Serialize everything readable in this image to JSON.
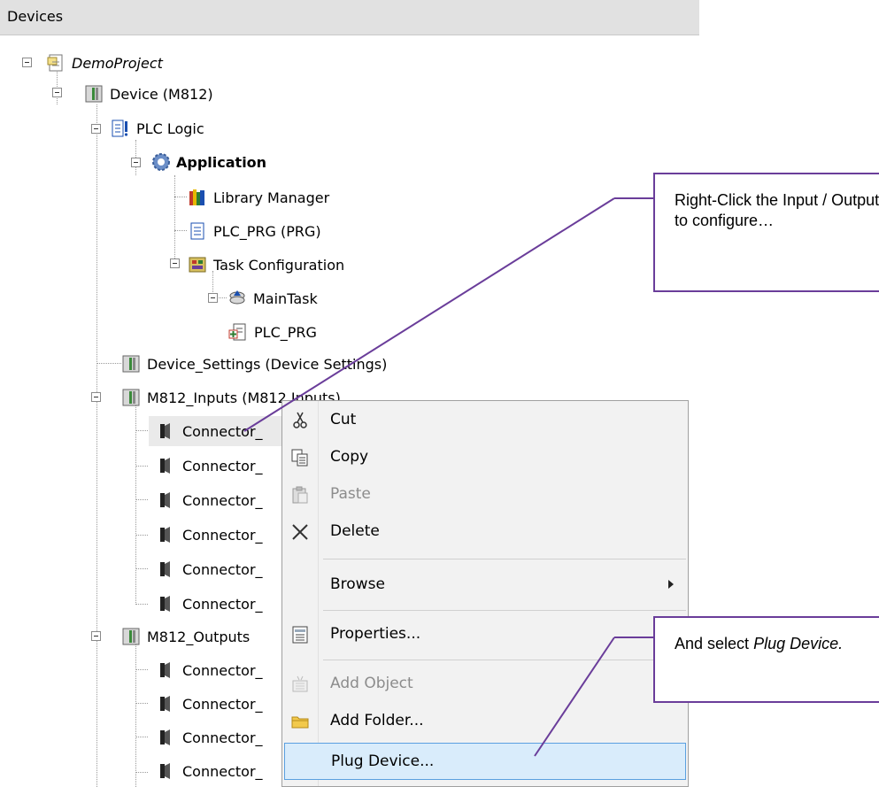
{
  "panel": {
    "title": "Devices"
  },
  "tree": {
    "items": [
      {
        "label": "DemoProject",
        "icon": "project-icon"
      },
      {
        "label": "Device (M812)",
        "icon": "device-icon"
      },
      {
        "label": "PLC Logic",
        "icon": "plc-logic-icon"
      },
      {
        "label": "Application",
        "icon": "application-gear-icon"
      },
      {
        "label": "Library Manager",
        "icon": "library-books-icon"
      },
      {
        "label": "PLC_PRG (PRG)",
        "icon": "program-document-icon"
      },
      {
        "label": "Task Configuration",
        "icon": "task-configuration-icon"
      },
      {
        "label": "MainTask",
        "icon": "task-icon"
      },
      {
        "label": "PLC_PRG",
        "icon": "program-call-icon"
      },
      {
        "label": "Device_Settings (Device Settings)",
        "icon": "device-icon"
      },
      {
        "label": "M812_Inputs (M812 Inputs)",
        "icon": "device-icon"
      },
      {
        "label": "Connector_",
        "icon": "connector-icon"
      },
      {
        "label": "Connector_",
        "icon": "connector-icon"
      },
      {
        "label": "Connector_",
        "icon": "connector-icon"
      },
      {
        "label": "Connector_",
        "icon": "connector-icon"
      },
      {
        "label": "Connector_",
        "icon": "connector-icon"
      },
      {
        "label": "Connector_",
        "icon": "connector-icon"
      },
      {
        "label": "M812_Outputs",
        "icon": "device-icon"
      },
      {
        "label": "Connector_",
        "icon": "connector-icon"
      },
      {
        "label": "Connector_",
        "icon": "connector-icon"
      },
      {
        "label": "Connector_",
        "icon": "connector-icon"
      },
      {
        "label": "Connector_",
        "icon": "connector-icon"
      }
    ]
  },
  "context_menu": {
    "items": [
      {
        "label": "Cut",
        "icon": "scissors-icon"
      },
      {
        "label": "Copy",
        "icon": "copy-icon"
      },
      {
        "label": "Paste",
        "icon": "paste-icon"
      },
      {
        "label": "Delete",
        "icon": "delete-x-icon"
      },
      {
        "label": "Browse",
        "icon": ""
      },
      {
        "label": "Properties...",
        "icon": "properties-icon"
      },
      {
        "label": "Add Object",
        "icon": "add-object-icon"
      },
      {
        "label": "Add Folder...",
        "icon": "folder-icon"
      },
      {
        "label": "Plug Device...",
        "icon": ""
      }
    ]
  },
  "callouts": {
    "first": "Right-Click the Input / Output to configure…",
    "second_prefix": "And select ",
    "second_emph": "Plug Device."
  },
  "colors": {
    "callout_border": "#6a3d9a",
    "highlight": "#d9ecfb"
  }
}
